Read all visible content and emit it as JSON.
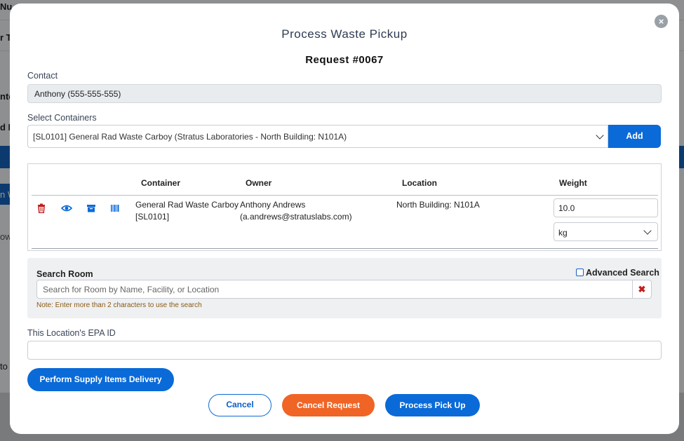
{
  "background": {
    "fragments": [
      "Nu",
      "r Ty",
      "nter",
      "d E",
      "n W",
      "ow",
      "to"
    ]
  },
  "modal": {
    "title": "Process Waste Pickup",
    "request_label": "Request #0067",
    "close_icon": "×"
  },
  "contact": {
    "label": "Contact",
    "value": "Anthony (555-555-555)"
  },
  "containers": {
    "label": "Select Containers",
    "selected": "[SL0101] General Rad Waste Carboy (Stratus Laboratories - North Building: N101A)",
    "add_label": "Add"
  },
  "table": {
    "headers": {
      "container": "Container",
      "owner": "Owner",
      "location": "Location",
      "weight": "Weight"
    },
    "rows": [
      {
        "container_name": "General Rad Waste Carboy",
        "container_id": "[SL0101]",
        "owner_name": "Anthony Andrews",
        "owner_email": "(a.andrews@stratuslabs.com)",
        "location": "North Building: N101A",
        "weight": "10.0",
        "unit": "kg"
      }
    ],
    "icons": [
      "trash-icon",
      "eye-icon",
      "archive-icon",
      "barcode-icon"
    ]
  },
  "search_room": {
    "label": "Search Room",
    "advanced_label": "Advanced Search",
    "placeholder": "Search for Room by Name, Facility, or Location",
    "clear_icon": "✖",
    "note": "Note: Enter more than 2 characters to use the search"
  },
  "epa": {
    "label": "This Location's EPA ID",
    "value": ""
  },
  "buttons": {
    "supply": "Perform Supply Items Delivery",
    "cancel": "Cancel",
    "cancel_request": "Cancel Request",
    "process": "Process Pick Up"
  },
  "colors": {
    "primary": "#0a6ad8",
    "danger": "#f06425",
    "trash": "#c0201e"
  }
}
